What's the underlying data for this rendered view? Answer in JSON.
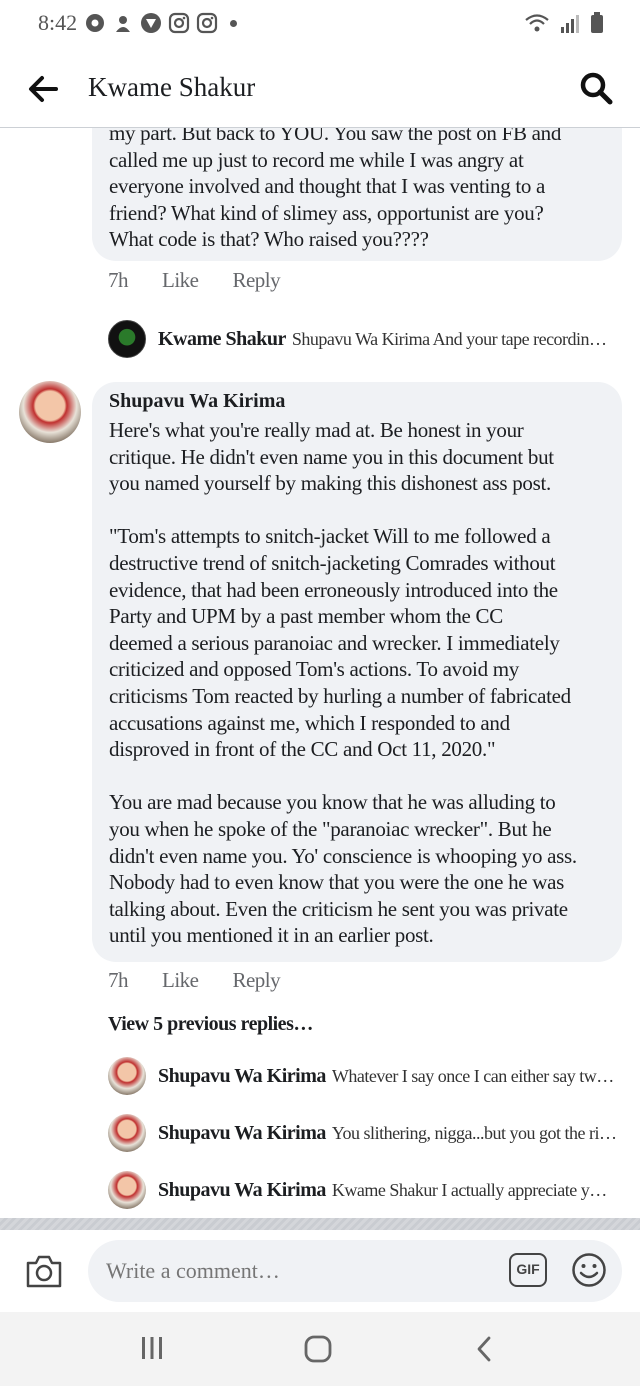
{
  "status": {
    "time": "8:42"
  },
  "header": {
    "title": "Kwame Shakur"
  },
  "comment1": {
    "text_top": "my part. But back to YOU. You saw the post on FB and",
    "text": "called me up just to record me while I was angry at\neveryone involved and thought that I was venting to a\nfriend? What kind of slimey ass, opportunist are you?\nWhat code is that? Who raised you????",
    "time": "7h",
    "like": "Like",
    "reply": "Reply"
  },
  "reply_kwame": {
    "name": "Kwame Shakur",
    "text": "Shupavu Wa Kirima And your tape recordin…"
  },
  "comment2": {
    "author": "Shupavu Wa Kirima",
    "text": "Here's what you're really mad at. Be honest in your\ncritique. He didn't even name you in this document but\nyou named yourself by making this dishonest ass post.\n\n\"Tom's attempts to snitch-jacket Will to me followed a\ndestructive trend of snitch-jacketing Comrades without\nevidence, that had been erroneously introduced into the\nParty and UPM by a past member whom the CC\ndeemed a serious paranoiac and wrecker. I immediately\ncriticized and opposed Tom's actions. To avoid my\ncriticisms Tom reacted by hurling a number of fabricated\naccusations against me, which I responded to and\ndisproved in front of the CC and Oct 11, 2020.\"\n\nYou are mad because you know that he was alluding to\nyou when he spoke of the \"paranoiac wrecker\". But he\ndidn't even name you. Yo' conscience is whooping yo ass.\nNobody had to even know that you were the one he was\ntalking about. Even the criticism he sent you was private\nuntil you mentioned it in an earlier post.",
    "time": "7h",
    "like": "Like",
    "reply": "Reply",
    "view_previous": "View 5 previous replies…"
  },
  "replies": [
    {
      "name": "Shupavu Wa Kirima",
      "text": "Whatever I say once I can either say tw…"
    },
    {
      "name": "Shupavu Wa Kirima",
      "text": "You slithering, nigga...but you got the ri…"
    },
    {
      "name": "Shupavu Wa Kirima",
      "text": "Kwame Shakur I actually appreciate y…"
    }
  ],
  "composer": {
    "placeholder": "Write a comment…",
    "gif_label": "GIF"
  },
  "colors": {
    "bubble": "#f0f2f5",
    "meta": "#65676b",
    "text": "#1c1e21"
  }
}
